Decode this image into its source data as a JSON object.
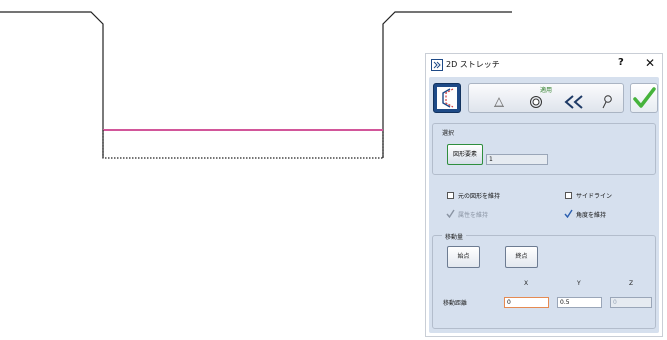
{
  "dialog": {
    "title": "2D ストレッチ",
    "help_label": "?",
    "close_label": "✕"
  },
  "tabs": {
    "label": "適用",
    "icons": [
      "triangle-icon",
      "target-icon",
      "double-chevron-icon",
      "pin-icon"
    ]
  },
  "selection": {
    "group_label": "選択",
    "button_label": "図形要素",
    "count_value": "1"
  },
  "options": {
    "keep_original": "元の図形を維持",
    "side_line": "サイドライン",
    "keep_attributes": "属性を維持",
    "keep_angle": "角度を維持"
  },
  "movement": {
    "group_label": "移動量",
    "start_button": "始点",
    "end_button": "終点",
    "axis_x": "X",
    "axis_y": "Y",
    "axis_z": "Z",
    "distance_label": "移動距離",
    "x_value": "0",
    "y_value": "0.5",
    "z_value": "0"
  },
  "colors": {
    "accent_blue": "#1e4a87",
    "highlight_pink": "#d2569a",
    "active_field": "#e58a52",
    "ok_green": "#46b33c"
  }
}
